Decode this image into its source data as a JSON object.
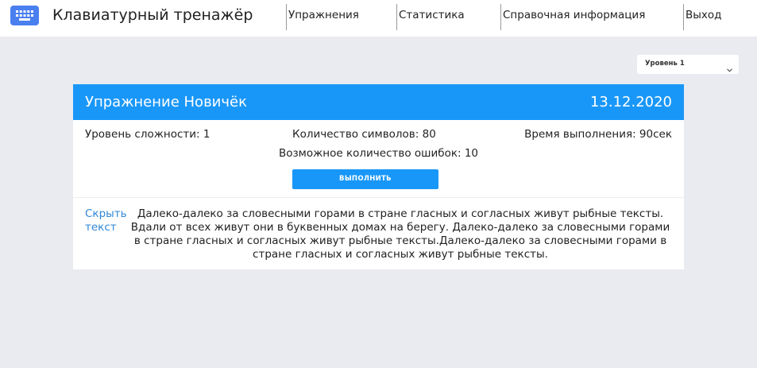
{
  "navbar": {
    "logo_icon": "keyboard-icon",
    "app_title": "Клавиатурный тренажёр",
    "items": [
      {
        "label": "Упражнения"
      },
      {
        "label": "Статистика"
      },
      {
        "label": "Справочная информация"
      },
      {
        "label": "Выход"
      }
    ]
  },
  "level_select": {
    "value": "Уровень 1",
    "icon": "chevron-down-icon"
  },
  "exercise": {
    "title": "Упражнение Новичёк",
    "date": "13.12.2020",
    "difficulty": "Уровень сложности: 1",
    "char_count": "Количество символов: 80",
    "time": "Время выполнения: 90сек",
    "max_errors": "Возможное количество ошибок: 10",
    "run_label": "ВЫПОЛНИТЬ",
    "toggle_label": "Скрыть текст",
    "text": "Далеко-далеко за словесными горами в стране гласных и согласных живут рыбные тексты. Вдали от всех живут они в буквенных домах на берегу. Далеко-далеко за словесными горами в стране гласных и согласных живут рыбные тексты.Далеко-далеко за словесными горами в стране гласных и согласных живут рыбные тексты."
  },
  "colors": {
    "accent": "#1997f8",
    "background": "#e9ebf1",
    "logo": "#4a7ff0",
    "link": "#2f86d6"
  }
}
